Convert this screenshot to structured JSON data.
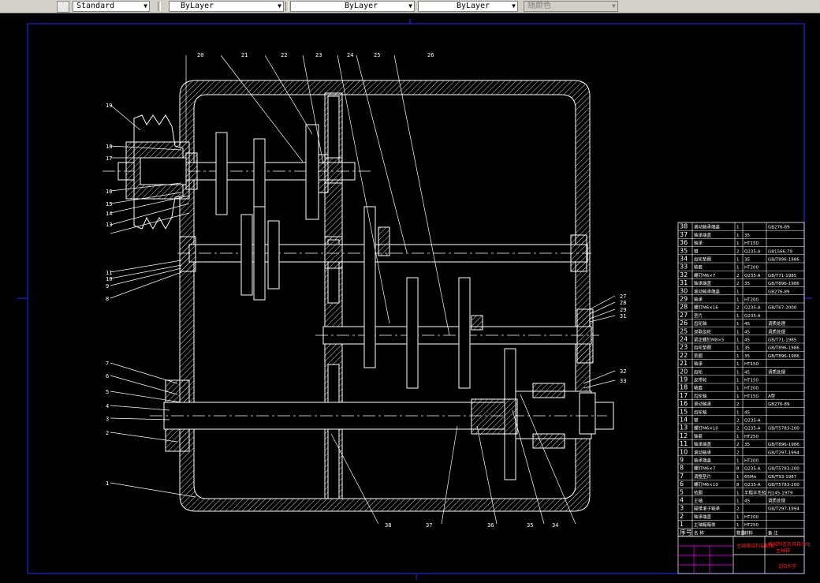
{
  "toolbar": {
    "textstyle": "Standard",
    "layer": "ByLayer",
    "linetype": "ByLayer",
    "lineweight": "ByLayer",
    "color": "随颜色"
  },
  "leaders_top": [
    "20",
    "21",
    "22",
    "23",
    "24",
    "25",
    "26"
  ],
  "leaders_left": [
    "19",
    "18",
    "17",
    "16",
    "15",
    "14",
    "13",
    "11",
    "10",
    "9",
    "8",
    "7",
    "6",
    "5",
    "4",
    "3",
    "2",
    "1"
  ],
  "leaders_right": [
    "27",
    "28",
    "29",
    "31",
    "32",
    "33"
  ],
  "leaders_bottom": [
    "38",
    "37",
    "36",
    "35",
    "34"
  ],
  "bom_rows": [
    {
      "no": "38",
      "name": "滚动轴承端盖",
      "qty": "1",
      "mat": "",
      "std": "GB276-89"
    },
    {
      "no": "37",
      "name": "轴承端盖",
      "qty": "1",
      "mat": "35",
      "std": ""
    },
    {
      "no": "36",
      "name": "轴承",
      "qty": "1",
      "mat": "HT150",
      "std": ""
    },
    {
      "no": "35",
      "name": "键",
      "qty": "2",
      "mat": "Q235-A",
      "std": "GB1566-79"
    },
    {
      "no": "34",
      "name": "齿轮垫圈",
      "qty": "1",
      "mat": "35",
      "std": "GB/T896-1986"
    },
    {
      "no": "33",
      "name": "轴套",
      "qty": "1",
      "mat": "HT200",
      "std": ""
    },
    {
      "no": "32",
      "name": "螺钉M6×7",
      "qty": "2",
      "mat": "Q235-A",
      "std": "GB/T71-1985"
    },
    {
      "no": "31",
      "name": "轴承端盖",
      "qty": "2",
      "mat": "35",
      "std": "GB/T896-1986"
    },
    {
      "no": "30",
      "name": "滚动轴承端盖",
      "qty": "1",
      "mat": "",
      "std": "GB276-89"
    },
    {
      "no": "29",
      "name": "轴承",
      "qty": "1",
      "mat": "HT200",
      "std": ""
    },
    {
      "no": "28",
      "name": "螺钉M6×16",
      "qty": "2",
      "mat": "Q235-A",
      "std": "GB/T67-2000"
    },
    {
      "no": "27",
      "name": "垫片",
      "qty": "1",
      "mat": "Q235-A",
      "std": ""
    },
    {
      "no": "26",
      "name": "齿轮轴",
      "qty": "1",
      "mat": "45",
      "std": "调质处理"
    },
    {
      "no": "25",
      "name": "双联齿轮",
      "qty": "1",
      "mat": "45",
      "std": "调质处理"
    },
    {
      "no": "24",
      "name": "紧定螺钉M8×5",
      "qty": "1",
      "mat": "45",
      "std": "GB/T71-1985"
    },
    {
      "no": "23",
      "name": "齿轮垫圈",
      "qty": "1",
      "mat": "35",
      "std": "GB/T896-1986"
    },
    {
      "no": "22",
      "name": "垫圈",
      "qty": "1",
      "mat": "35",
      "std": "GB/T896-1986"
    },
    {
      "no": "21",
      "name": "轴承",
      "qty": "1",
      "mat": "HT150",
      "std": ""
    },
    {
      "no": "20",
      "name": "齿轮",
      "qty": "1",
      "mat": "45",
      "std": "调质处理"
    },
    {
      "no": "19",
      "name": "皮带轮",
      "qty": "1",
      "mat": "HT150",
      "std": ""
    },
    {
      "no": "18",
      "name": "轴套",
      "qty": "1",
      "mat": "HT200",
      "std": ""
    },
    {
      "no": "17",
      "name": "齿轮轴",
      "qty": "1",
      "mat": "HT150",
      "std": "A型"
    },
    {
      "no": "16",
      "name": "滚动轴承",
      "qty": "2",
      "mat": "",
      "std": "GB276-89"
    },
    {
      "no": "15",
      "name": "齿轮轴",
      "qty": "1",
      "mat": "45",
      "std": ""
    },
    {
      "no": "14",
      "name": "键",
      "qty": "2",
      "mat": "Q235-A",
      "std": ""
    },
    {
      "no": "13",
      "name": "螺钉M6×10",
      "qty": "2",
      "mat": "Q235-A",
      "std": "GB/T5783-200"
    },
    {
      "no": "12",
      "name": "轴套",
      "qty": "1",
      "mat": "HT250",
      "std": ""
    },
    {
      "no": "11",
      "name": "轴承端盖",
      "qty": "2",
      "mat": "35",
      "std": "GB/T896-1986"
    },
    {
      "no": "10",
      "name": "滚动轴承",
      "qty": "2",
      "mat": "",
      "std": "GB/T297-1994"
    },
    {
      "no": "9",
      "name": "轴承端盖",
      "qty": "1",
      "mat": "HT200",
      "std": ""
    },
    {
      "no": "8",
      "name": "螺钉M6×7",
      "qty": "8",
      "mat": "Q235-A",
      "std": "GB/T5783-200"
    },
    {
      "no": "7",
      "name": "调整垫片",
      "qty": "1",
      "mat": "65Mn",
      "std": "GB/T93-1987"
    },
    {
      "no": "6",
      "name": "螺钉M6×10",
      "qty": "8",
      "mat": "Q235-A",
      "std": "GB/T5783-200"
    },
    {
      "no": "5",
      "name": "毡圈",
      "qty": "1",
      "mat": "半粗羊毛毡",
      "std": "FJ145-1979"
    },
    {
      "no": "4",
      "name": "主轴",
      "qty": "1",
      "mat": "45",
      "std": "调质处理"
    },
    {
      "no": "3",
      "name": "圆锥滚子轴承",
      "qty": "2",
      "mat": "",
      "std": "GB/T297-1994"
    },
    {
      "no": "2",
      "name": "轴承端盖",
      "qty": "1",
      "mat": "HT200",
      "std": ""
    },
    {
      "no": "1",
      "name": "主轴箱箱体",
      "qty": "1",
      "mat": "HT250",
      "std": ""
    }
  ],
  "bom_header": [
    "序号",
    "名 称",
    "数量",
    "材料",
    "备 注"
  ],
  "title_block": {
    "drawing_name": "主轴箱结构装配图",
    "school": "机械制造及其自动化",
    "drawing_no": "主轴箱",
    "company": "沈阳大学"
  },
  "colors": {
    "background": "#000000",
    "lines": "#ffffff",
    "border": "#0000ff",
    "title_text": "#ff0000",
    "magenta": "#ff00ff",
    "centerline": "#ffffff"
  }
}
